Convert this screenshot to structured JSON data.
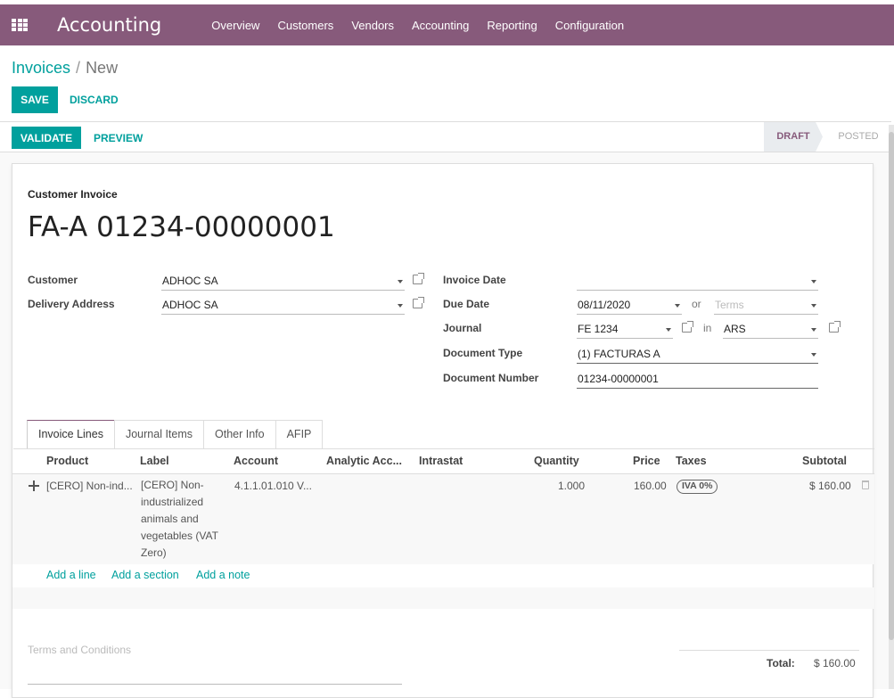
{
  "navbar": {
    "brand": "Accounting",
    "menu": [
      "Overview",
      "Customers",
      "Vendors",
      "Accounting",
      "Reporting",
      "Configuration"
    ],
    "background": "#875A7B"
  },
  "breadcrumb": {
    "parent": "Invoices",
    "separator": "/",
    "current": "New"
  },
  "buttons": {
    "save": "Save",
    "discard": "Discard",
    "validate": "Validate",
    "preview": "Preview"
  },
  "statusbar": {
    "stages": [
      "Draft",
      "Posted"
    ],
    "active": "Draft"
  },
  "invoice": {
    "type": "Customer Invoice",
    "number": "FA-A 01234-00000001",
    "labels": {
      "customer": "Customer",
      "delivery": "Delivery Address",
      "invoice_date": "Invoice Date",
      "due_date": "Due Date",
      "journal": "Journal",
      "document_type": "Document Type",
      "document_number": "Document Number"
    },
    "values": {
      "customer": "ADHOC SA",
      "delivery": "ADHOC SA",
      "invoice_date": "",
      "due_date": "08/11/2020",
      "or": "or",
      "terms_placeholder": "Terms",
      "journal": "FE 1234",
      "in": "in",
      "currency": "ARS",
      "document_type": "(1) FACTURAS A",
      "document_number": "01234-00000001"
    }
  },
  "tabs": [
    "Invoice Lines",
    "Journal Items",
    "Other Info",
    "AFIP"
  ],
  "table": {
    "headers": [
      "Product",
      "Label",
      "Account",
      "Analytic Acc...",
      "Intrastat",
      "Quantity",
      "Price",
      "Taxes",
      "Subtotal"
    ],
    "rows": [
      {
        "product": "[CERO] Non-ind...",
        "label": "[CERO] Non-industrialized animals and vegetables (VAT Zero)",
        "account": "4.1.1.01.010 V...",
        "analytic": "",
        "intrastat": "",
        "quantity": "1.000",
        "price": "160.00",
        "tax": "IVA 0%",
        "subtotal": "$ 160.00"
      }
    ],
    "add_links": [
      "Add a line",
      "Add a section",
      "Add a note"
    ]
  },
  "footer": {
    "terms_placeholder": "Terms and Conditions",
    "total_label": "Total:",
    "total_value": "$ 160.00"
  },
  "colors": {
    "primary": "#00A09D",
    "brand": "#875A7B"
  }
}
